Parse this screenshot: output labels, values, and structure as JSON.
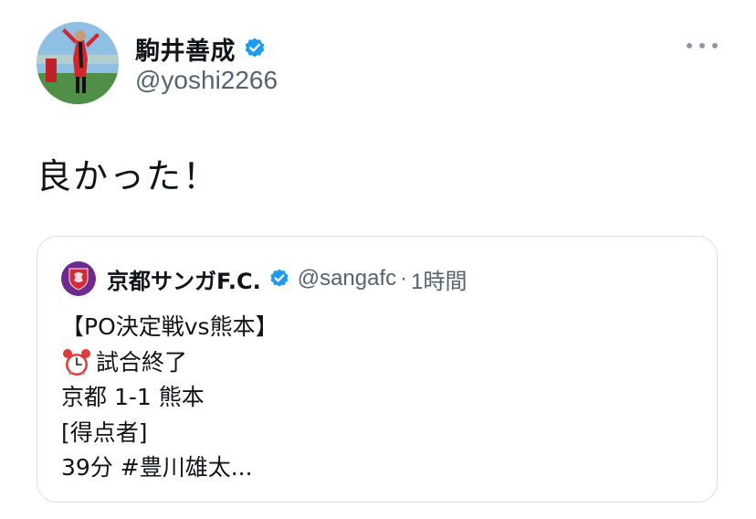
{
  "tweet": {
    "author": {
      "display_name": "駒井善成",
      "handle": "@yoshi2266",
      "verified": true
    },
    "text": "良かった！",
    "more_icon": "more-horizontal-icon"
  },
  "quoted_tweet": {
    "author": {
      "display_name": "京都サンガF.C.",
      "handle": "@sangafc",
      "separator": "·",
      "time": "1時間",
      "verified": true
    },
    "lines": [
      "【PO決定戦vs熊本】",
      "試合終了",
      "京都 1-1 熊本",
      "[得点者]",
      "39分 #豊川雄太..."
    ],
    "alarm_icon": "alarm-clock-icon"
  },
  "colors": {
    "verified_blue": "#1d9bf0",
    "secondary_text": "#536471",
    "border": "#d6dde3",
    "club_purple": "#6d2a8c"
  }
}
